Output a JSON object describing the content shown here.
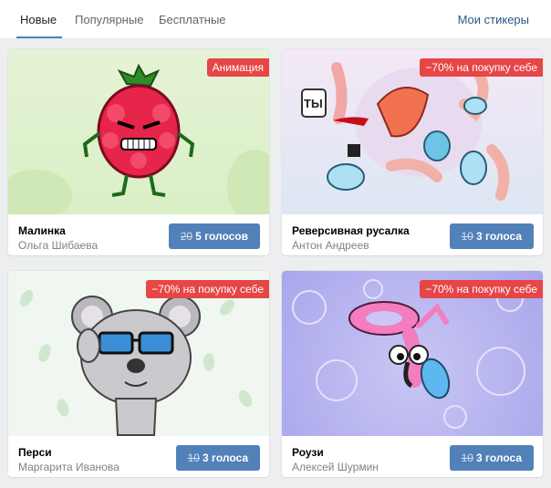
{
  "tabs": [
    {
      "label": "Новые",
      "active": true
    },
    {
      "label": "Популярные",
      "active": false
    },
    {
      "label": "Бесплатные",
      "active": false
    }
  ],
  "my_stickers_label": "Мои стикеры",
  "packs": [
    {
      "title": "Малинка",
      "author": "Ольга Шибаева",
      "badge": "Анимация",
      "old_price": "20",
      "price_label": "5 голосов",
      "image_icon": "raspberry-sticker"
    },
    {
      "title": "Реверсивная русалка",
      "author": "Антон Андреев",
      "badge": "−70% на покупку себе",
      "old_price": "10",
      "price_label": "3 голоса",
      "image_icon": "mermaid-sticker",
      "sticker_text": "ТЫ"
    },
    {
      "title": "Перси",
      "author": "Маргарита Иванова",
      "badge": "−70% на покупку себе",
      "old_price": "10",
      "price_label": "3 голоса",
      "image_icon": "koala-sticker"
    },
    {
      "title": "Роузи",
      "author": "Алексей Шурмин",
      "badge": "−70% на покупку себе",
      "old_price": "10",
      "price_label": "3 голоса",
      "image_icon": "flamingo-sticker"
    }
  ],
  "colors": {
    "accent": "#5181b8",
    "badge": "#e64646",
    "link": "#2a5885"
  }
}
